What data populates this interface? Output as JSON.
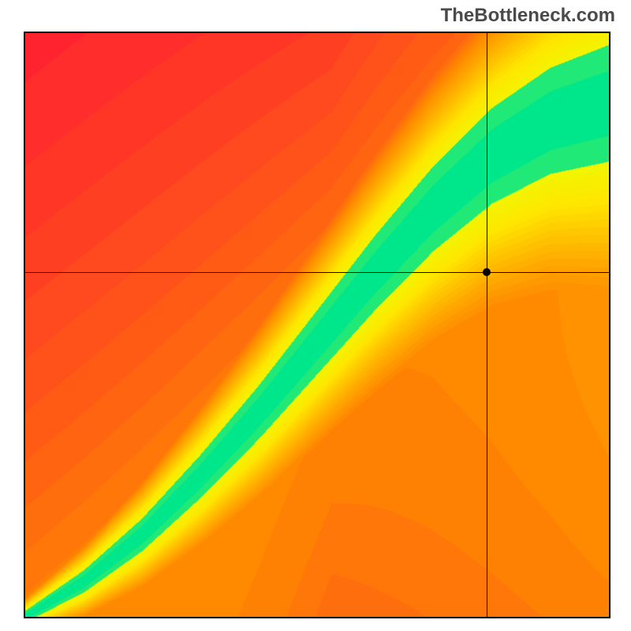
{
  "watermark": "TheBottleneck.com",
  "chart_data": {
    "type": "heatmap",
    "title": "",
    "xlabel": "",
    "ylabel": "",
    "xlim": [
      0,
      1
    ],
    "ylim": [
      0,
      1
    ],
    "crosshair": {
      "x": 0.79,
      "y": 0.59
    },
    "marker": {
      "x": 0.79,
      "y": 0.59
    },
    "color_scale": {
      "low": "#ff1a33",
      "mid_low": "#ff8a00",
      "mid": "#ffe600",
      "mid_high": "#eaff00",
      "high": "#00e68a"
    },
    "curve": {
      "description": "Optimal bottleneck-free band along a superlinear diagonal curve",
      "control_points_x": [
        0.0,
        0.1,
        0.2,
        0.3,
        0.4,
        0.5,
        0.6,
        0.7,
        0.8,
        0.9,
        1.0
      ],
      "control_points_y": [
        0.0,
        0.06,
        0.14,
        0.24,
        0.35,
        0.47,
        0.59,
        0.7,
        0.79,
        0.85,
        0.88
      ],
      "band_half_width_start": 0.01,
      "band_half_width_end": 0.1
    },
    "resolution": 100
  }
}
